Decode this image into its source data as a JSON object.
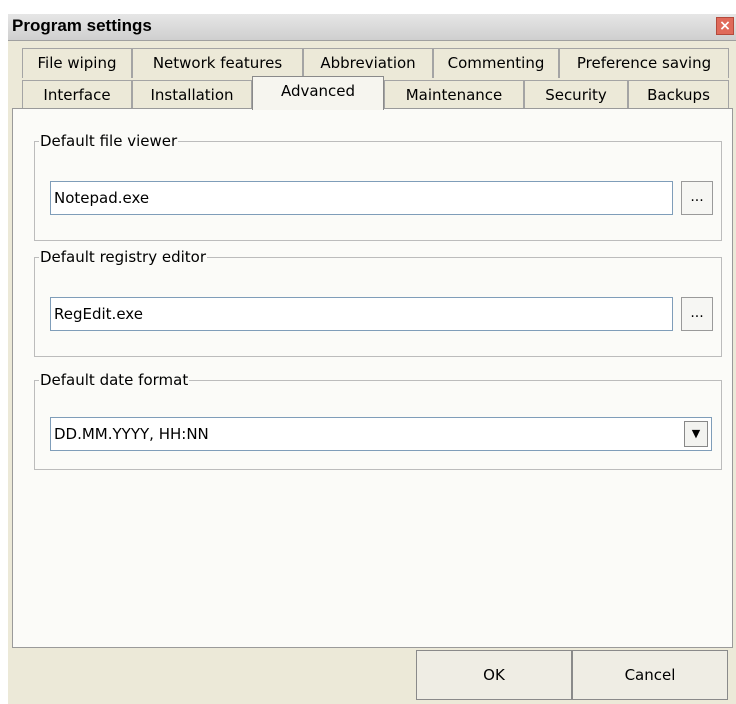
{
  "window": {
    "title": "Program settings",
    "close_glyph": "×"
  },
  "tabs": {
    "row_top": [
      "File wiping",
      "Network features",
      "Abbreviation",
      "Commenting",
      "Preference saving"
    ],
    "row_bottom": [
      "Interface",
      "Installation",
      "Advanced",
      "Maintenance",
      "Security",
      "Backups"
    ],
    "active": "Advanced"
  },
  "advanced": {
    "file_viewer": {
      "legend": "Default file viewer",
      "value": "Notepad.exe",
      "browse_label": "..."
    },
    "registry_editor": {
      "legend": "Default registry editor",
      "value": "RegEdit.exe",
      "browse_label": "..."
    },
    "date_format": {
      "legend": "Default date format",
      "value": "DD.MM.YYYY, HH:NN",
      "arrow": "▼"
    }
  },
  "footer": {
    "ok_label": "OK",
    "cancel_label": "Cancel"
  },
  "icons": {
    "close": "close-icon",
    "dropdown": "chevron-down-icon"
  },
  "colors": {
    "close_button": "#e06a5a",
    "panel": "#fbfbf8",
    "chrome": "#ece9d8"
  }
}
